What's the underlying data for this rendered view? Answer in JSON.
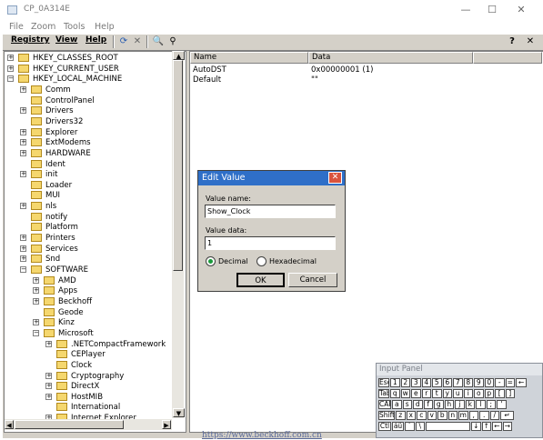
{
  "window": {
    "title": "CP_0A314E",
    "menu": [
      "File",
      "Zoom",
      "Tools",
      "Help"
    ],
    "controls": {
      "minimize": "—",
      "maximize": "☐",
      "close": "✕"
    }
  },
  "device_toolbar": {
    "menus": [
      "Registry",
      "View",
      "Help"
    ],
    "help_icon": "?"
  },
  "tree": {
    "items": [
      {
        "label": "HKEY_CLASSES_ROOT",
        "level": 0,
        "expander": "+"
      },
      {
        "label": "HKEY_CURRENT_USER",
        "level": 0,
        "expander": "+"
      },
      {
        "label": "HKEY_LOCAL_MACHINE",
        "level": 0,
        "expander": "−"
      },
      {
        "label": "Comm",
        "level": 1,
        "expander": "+"
      },
      {
        "label": "ControlPanel",
        "level": 1,
        "expander": ""
      },
      {
        "label": "Drivers",
        "level": 1,
        "expander": "+"
      },
      {
        "label": "Drivers32",
        "level": 1,
        "expander": ""
      },
      {
        "label": "Explorer",
        "level": 1,
        "expander": "+"
      },
      {
        "label": "ExtModems",
        "level": 1,
        "expander": "+"
      },
      {
        "label": "HARDWARE",
        "level": 1,
        "expander": "+"
      },
      {
        "label": "Ident",
        "level": 1,
        "expander": ""
      },
      {
        "label": "init",
        "level": 1,
        "expander": "+"
      },
      {
        "label": "Loader",
        "level": 1,
        "expander": ""
      },
      {
        "label": "MUI",
        "level": 1,
        "expander": ""
      },
      {
        "label": "nls",
        "level": 1,
        "expander": "+"
      },
      {
        "label": "notify",
        "level": 1,
        "expander": ""
      },
      {
        "label": "Platform",
        "level": 1,
        "expander": ""
      },
      {
        "label": "Printers",
        "level": 1,
        "expander": "+"
      },
      {
        "label": "Services",
        "level": 1,
        "expander": "+"
      },
      {
        "label": "Snd",
        "level": 1,
        "expander": "+"
      },
      {
        "label": "SOFTWARE",
        "level": 1,
        "expander": "−"
      },
      {
        "label": "AMD",
        "level": 2,
        "expander": "+"
      },
      {
        "label": "Apps",
        "level": 2,
        "expander": "+"
      },
      {
        "label": "Beckhoff",
        "level": 2,
        "expander": "+"
      },
      {
        "label": "Geode",
        "level": 2,
        "expander": ""
      },
      {
        "label": "Kinz",
        "level": 2,
        "expander": "+"
      },
      {
        "label": "Microsoft",
        "level": 2,
        "expander": "−"
      },
      {
        "label": ".NETCompactFramework",
        "level": 3,
        "expander": "+"
      },
      {
        "label": "CEPlayer",
        "level": 3,
        "expander": ""
      },
      {
        "label": "Clock",
        "level": 3,
        "expander": ""
      },
      {
        "label": "Cryptography",
        "level": 3,
        "expander": "+"
      },
      {
        "label": "DirectX",
        "level": 3,
        "expander": "+"
      },
      {
        "label": "HostMIB",
        "level": 3,
        "expander": "+"
      },
      {
        "label": "International",
        "level": 3,
        "expander": ""
      },
      {
        "label": "Internet Explorer",
        "level": 3,
        "expander": "+"
      }
    ]
  },
  "list": {
    "columns": [
      "Name",
      "Data"
    ],
    "rows": [
      {
        "name": "AutoDST",
        "data": "0x00000001 (1)"
      },
      {
        "name": "Default",
        "data": "\"\""
      }
    ]
  },
  "dialog": {
    "title": "Edit Value",
    "close": "✕",
    "value_name_label": "Value name:",
    "value_name": "Show_Clock",
    "value_data_label": "Value data:",
    "value_data": "1",
    "radio_decimal": "Decimal",
    "radio_hex": "Hexadecimal",
    "selected_radix": "Decimal",
    "ok": "OK",
    "cancel": "Cancel"
  },
  "input_panel": {
    "title": "Input Panel",
    "rows": [
      [
        "Esc",
        "1",
        "2",
        "3",
        "4",
        "5",
        "6",
        "7",
        "8",
        "9",
        "0",
        "-",
        "=",
        "←"
      ],
      [
        "Tab",
        "q",
        "w",
        "e",
        "r",
        "t",
        "y",
        "u",
        "i",
        "o",
        "p",
        "[",
        "]"
      ],
      [
        "CAP",
        "a",
        "s",
        "d",
        "f",
        "g",
        "h",
        "j",
        "k",
        "l",
        ";",
        "'"
      ],
      [
        "Shift",
        "z",
        "x",
        "c",
        "v",
        "b",
        "n",
        "m",
        ",",
        ".",
        "/",
        "↵"
      ],
      [
        "Ctl",
        "áü",
        "`",
        "\\",
        "",
        "↓",
        "↑",
        "←",
        "→"
      ]
    ]
  },
  "background_text": {
    "url_fragment": "https://www.beckhoff.com.cn"
  }
}
